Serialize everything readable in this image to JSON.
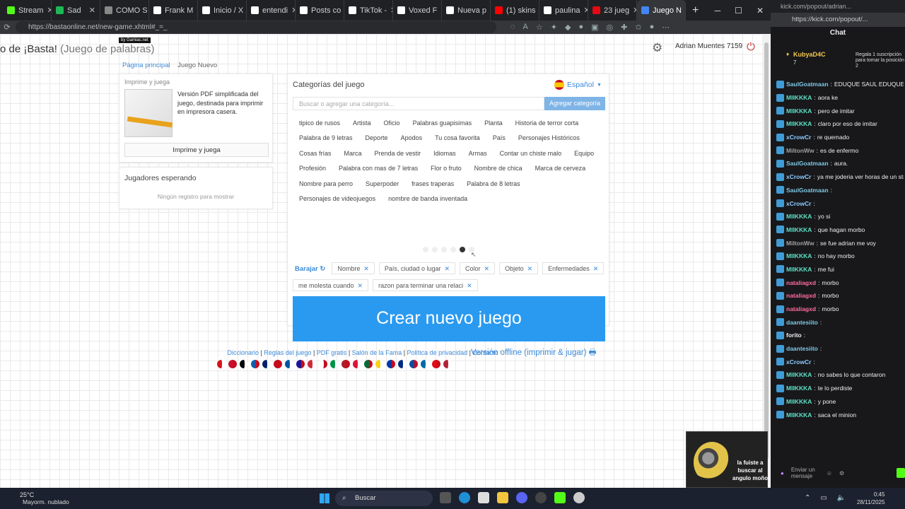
{
  "browser": {
    "tabs": [
      {
        "label": "Stream",
        "color": "#53fc18"
      },
      {
        "label": "Sad",
        "color": "#1db954"
      },
      {
        "label": "COMO S",
        "color": "#888888"
      },
      {
        "label": "Frank M",
        "color": "#ffffff"
      },
      {
        "label": "Inicio / X",
        "color": "#ffffff"
      },
      {
        "label": "entendi",
        "color": "#ffffff"
      },
      {
        "label": "Posts co",
        "color": "#ffffff"
      },
      {
        "label": "TikTok -",
        "color": "#ffffff"
      },
      {
        "label": "Voxed F",
        "color": "#ffffff"
      },
      {
        "label": "Nueva p",
        "color": "#ffffff"
      },
      {
        "label": "(1) skins",
        "color": "#ff0000"
      },
      {
        "label": "paulina",
        "color": "#ffffff"
      },
      {
        "label": "23 jueg",
        "color": "#e50914"
      },
      {
        "label": "Juego N",
        "color": "#4285f4"
      }
    ],
    "url": "https://bastaonline.net/new-game.xhtml#_=_"
  },
  "site": {
    "title_main": "o de ¡Basta!",
    "title_sub": "(Juego de palabras)",
    "badge": "by Gamiac.net",
    "user": "Adrian Muentes 7159",
    "breadcrumb": {
      "home": "Página principal",
      "current": "Juego Nuevo"
    }
  },
  "print_panel": {
    "header": "Imprime y juega",
    "description": "Versión PDF simplificada del juego, destinada para imprimir en impresora casera.",
    "button": "Imprime y juega"
  },
  "players_panel": {
    "header": "Jugadores esperando",
    "empty": "Ningún registro para mostrar"
  },
  "categories_panel": {
    "header": "Categorías del juego",
    "language": "Español",
    "search_placeholder": "Buscar o agregar una categoría...",
    "add_button": "Agregar categoría",
    "rows": [
      [
        "tipico de rusos",
        "Artista",
        "Oficio",
        "Palabras guapisimas",
        "Planta",
        "Historia de terror corta"
      ],
      [
        "Palabra de 9 letras",
        "Deporte",
        "Apodos",
        "Tu cosa favorita",
        "País",
        "Personajes Históricos"
      ],
      [
        "Cosas frías",
        "Marca",
        "Prenda de vestir",
        "Idiomas",
        "Armas",
        "Contar un chiste malo",
        "Equipo"
      ],
      [
        "Profesión",
        "Palabra con mas de 7 letras",
        "Flor o fruto",
        "Nombre de chica",
        "Marca de cerveza"
      ],
      [
        "Nombre para perro",
        "Superpoder",
        "frases traperas",
        "Palabra de 8 letras"
      ],
      [
        "Personajes de videojuegos",
        "nombre de banda inventada"
      ]
    ],
    "shuffle_label": "Barajar",
    "selected": [
      "Nombre",
      "País, ciudad o lugar",
      "Color",
      "Objeto",
      "Enfermedades",
      "me molesta cuando",
      "razon para terminar una relaci"
    ],
    "create_button": "Crear nuevo juego",
    "offline_link": "Versión offline (imprimir & jugar)"
  },
  "footer": {
    "links": [
      "Diccionario",
      "Reglas del juego",
      "PDF gratis",
      "Salón de la Fama",
      "Política de privacidad",
      "Contacto"
    ],
    "flags": [
      "#d7141a",
      "#c8102e",
      "#000000",
      "#0d5eaf",
      "#012169",
      "#c60b1e",
      "#0055a4",
      "#171796",
      "#ce2939",
      "#ffffff",
      "#009246",
      "#ae1c28",
      "#dc143c",
      "#046a38",
      "#fcd116",
      "#0039a6",
      "#002b7f",
      "#0b4ea2",
      "#006aa7",
      "#e30a17",
      "#b22234"
    ]
  },
  "chat": {
    "top_url": "kick.com/popout/adrian...",
    "url": "https://kick.com/popout/...",
    "title": "Chat",
    "pinned": {
      "name": "KubyaD4C",
      "count": "7",
      "note": "Regala 1 suscripción para tomar la posición 2"
    },
    "messages": [
      {
        "user": "SaulGoatmaan",
        "text": "EDUQUE SAUL EDUQUE",
        "color": "#7ec8e3"
      },
      {
        "user": "MIIKKKA",
        "text": "aora ke",
        "color": "#5ee0c5"
      },
      {
        "user": "MIIKKKA",
        "text": "pero de imitar",
        "color": "#5ee0c5"
      },
      {
        "user": "MIIKKKA",
        "text": "claro por eso de imitar",
        "color": "#5ee0c5"
      },
      {
        "user": "xCrowCr",
        "text": "re quemado",
        "color": "#8ecbff"
      },
      {
        "user": "MiltonWw",
        "text": "es de enfermo",
        "color": "#a0a0a0"
      },
      {
        "user": "SaulGoatmaan",
        "text": "aura.",
        "color": "#7ec8e3"
      },
      {
        "user": "xCrowCr",
        "text": "ya me joderia ver horas de un stream",
        "color": "#8ecbff"
      },
      {
        "user": "SaulGoatmaan",
        "text": "",
        "color": "#7ec8e3"
      },
      {
        "user": "xCrowCr",
        "text": "",
        "color": "#8ecbff"
      },
      {
        "user": "MIIKKKA",
        "text": "yo si",
        "color": "#5ee0c5"
      },
      {
        "user": "MIIKKKA",
        "text": "que hagan morbo",
        "color": "#5ee0c5"
      },
      {
        "user": "MiltonWw",
        "text": "se fue adrian me voy",
        "color": "#a0a0a0"
      },
      {
        "user": "MIIKKKA",
        "text": "no hay morbo",
        "color": "#5ee0c5"
      },
      {
        "user": "MIIKKKA",
        "text": "me fui",
        "color": "#5ee0c5"
      },
      {
        "user": "nataliagxd",
        "text": "morbo",
        "color": "#ff6b9d"
      },
      {
        "user": "nataliagxd",
        "text": "morbo",
        "color": "#ff6b9d"
      },
      {
        "user": "nataliagxd",
        "text": "morbo",
        "color": "#ff6b9d"
      },
      {
        "user": "daantesiito",
        "text": "",
        "color": "#7ec8e3"
      },
      {
        "user": "forito",
        "text": "",
        "color": "#efeff1"
      },
      {
        "user": "daantesiito",
        "text": "",
        "color": "#7ec8e3"
      },
      {
        "user": "xCrowCr",
        "text": "",
        "color": "#8ecbff"
      },
      {
        "user": "MIIKKKA",
        "text": "no sabes lo que contaron",
        "color": "#5ee0c5"
      },
      {
        "user": "MIIKKKA",
        "text": "te lo perdiste",
        "color": "#5ee0c5"
      },
      {
        "user": "MIIKKKA",
        "text": "y pone",
        "color": "#5ee0c5"
      },
      {
        "user": "MIIKKKA",
        "text": "saca el minion",
        "color": "#5ee0c5"
      }
    ],
    "send_hint": "Enviar un mensaje",
    "cam_caption": "la fuiste a buscar al angulo moño"
  },
  "taskbar": {
    "temperature": "25°C",
    "weather": "Mayorm. nublado",
    "search": "Buscar",
    "time": "0:45",
    "date": "28/11/2025"
  }
}
